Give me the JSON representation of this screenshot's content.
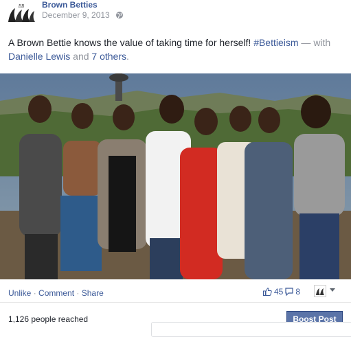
{
  "post": {
    "page_name": "Brown Betties",
    "date": "December 9, 2013",
    "logo_text": "Brown Betties",
    "text_main": "A Brown Bettie knows the value of taking time for herself! ",
    "hashtag": "#Bettieism",
    "with_sep": " — with",
    "tag_person": "Danielle Lewis",
    "tag_and": " and ",
    "tag_others": "7 others",
    "tag_end": "."
  },
  "actions": {
    "unlike": "Unlike",
    "comment": "Comment",
    "share": "Share",
    "dot": " · "
  },
  "stats": {
    "likes": "45",
    "comments": "8"
  },
  "footer": {
    "reach": "1,126 people reached",
    "boost_label": "Boost Post"
  },
  "colors": {
    "link": "#3b5998",
    "boost_bg": "#5b74a8"
  }
}
